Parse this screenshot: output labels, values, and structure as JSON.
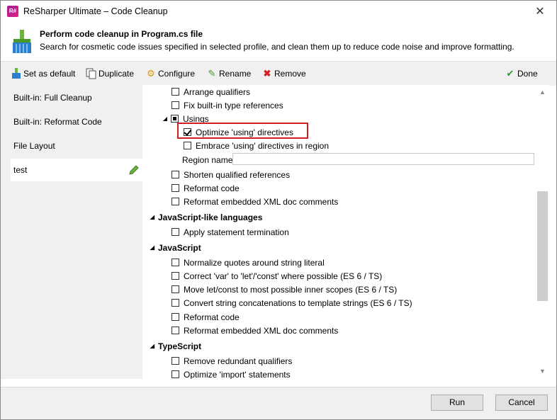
{
  "window": {
    "title": "ReSharper Ultimate – Code Cleanup",
    "app_icon": "resharper-icon",
    "close_glyph": "✕"
  },
  "header": {
    "title": "Perform code cleanup in Program.cs file",
    "description": "Search for cosmetic code issues specified in selected profile, and clean them up to reduce code noise and improve formatting."
  },
  "toolbar": {
    "set_default": "Set as default",
    "duplicate": "Duplicate",
    "configure": "Configure",
    "rename": "Rename",
    "remove": "Remove",
    "done": "Done"
  },
  "sidebar": {
    "items": [
      {
        "label": "Built-in: Full Cleanup"
      },
      {
        "label": "Built-in: Reformat Code"
      },
      {
        "label": "File Layout"
      },
      {
        "label": "test",
        "selected": true
      }
    ]
  },
  "tree": {
    "arrange_qualifiers": "Arrange qualifiers",
    "fix_builtin": "Fix built-in type references",
    "usings": "Usings",
    "optimize_using": "Optimize 'using' directives",
    "embrace_using": "Embrace 'using' directives in region",
    "region_name": "Region name",
    "shorten_refs": "Shorten qualified references",
    "reformat_code": "Reformat code",
    "reformat_xml": "Reformat embedded XML doc comments",
    "js_like": "JavaScript-like languages",
    "apply_statement": "Apply statement termination",
    "javascript": "JavaScript",
    "normalize_quotes": "Normalize quotes around string literal",
    "correct_var": "Correct 'var' to 'let'/'const' where possible (ES 6 / TS)",
    "move_let": "Move let/const to most possible inner scopes (ES 6 / TS)",
    "convert_concat": "Convert string concatenations to template strings (ES 6 / TS)",
    "js_reformat_code": "Reformat code",
    "js_reformat_xml": "Reformat embedded XML doc comments",
    "typescript": "TypeScript",
    "remove_redundant": "Remove redundant qualifiers",
    "optimize_import": "Optimize 'import' statements"
  },
  "footer": {
    "run": "Run",
    "cancel": "Cancel"
  },
  "colors": {
    "highlight": "#d02020",
    "accent": "#1e7ac8"
  }
}
